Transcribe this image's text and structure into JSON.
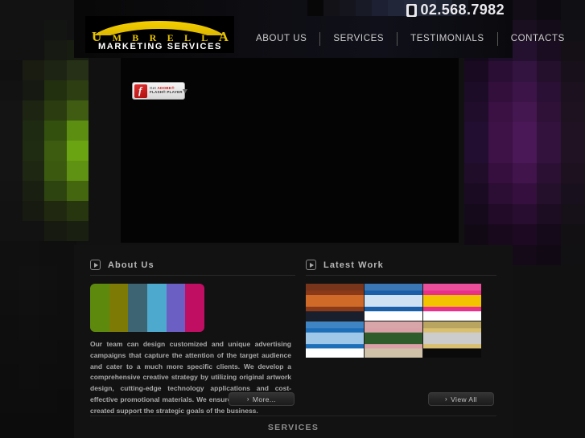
{
  "header": {
    "phone": "02.568.7982",
    "phone_icon": "phone-icon",
    "logo": {
      "word_letters": [
        "U",
        "M",
        "B",
        "R",
        "E",
        "L",
        "L",
        "A"
      ],
      "name": "UMBRELLA",
      "tagline": "MARKETING SERVICES"
    },
    "nav": [
      {
        "label": "ABOUT US"
      },
      {
        "label": "SERVICES"
      },
      {
        "label": "TESTIMONIALS"
      },
      {
        "label": "CONTACTS"
      }
    ]
  },
  "stage": {
    "flash_badge": {
      "line1_prefix": "Get ",
      "line1_brand": "ADOBE®",
      "line2": "FLASH® PLAYER",
      "icon": "adobe-flash-icon",
      "arrow_icon": "download-arrow-icon"
    }
  },
  "about": {
    "section_icon": "play-icon",
    "title": "About Us",
    "banner_colors": [
      "#5d8a0d",
      "#7d7a06",
      "#3c6473",
      "#4ea9ce",
      "#6c5fc4",
      "#c00f63"
    ],
    "body": "Our team can design customized and unique advertising campaigns that capture the attention of the target audience and cater to a much more specific clients. We develop a comprehensive creative strategy by utilizing original artwork design, cutting-edge technology applications and cost-effective promotional materials. We ensure that the materials created support the strategic goals of the business.",
    "more_button": {
      "label": "More...",
      "chevron": "›"
    }
  },
  "latest_work": {
    "section_icon": "play-icon",
    "title": "Latest Work",
    "thumbnails": [
      {
        "name": "thumbnail-runner-site",
        "colors": [
          "#1a1f2e",
          "#8a3a18",
          "#d06a28"
        ]
      },
      {
        "name": "thumbnail-blue-portal-site",
        "colors": [
          "#ffffff",
          "#1a5fa8",
          "#cfe2f3"
        ]
      },
      {
        "name": "thumbnail-colorful-infographic-site",
        "colors": [
          "#ffffff",
          "#e8308a",
          "#f3c300"
        ]
      },
      {
        "name": "thumbnail-city-corporate-site",
        "colors": [
          "#ffffff",
          "#1d6fb8",
          "#9fc7e8"
        ]
      },
      {
        "name": "thumbnail-resort-villa-site",
        "colors": [
          "#cfc2a8",
          "#d9a0a8",
          "#2e5c2a"
        ]
      },
      {
        "name": "thumbnail-jewelry-dark-site",
        "colors": [
          "#0a0a0a",
          "#d8c070",
          "#cccccc"
        ]
      }
    ],
    "view_all_button": {
      "label": "View All",
      "chevron": "›"
    }
  },
  "services": {
    "label": "SERVICES"
  },
  "decor": {
    "mosaic_left": [
      "#121212",
      "#121212",
      "#121212",
      "#121212",
      "#121212",
      "#121212",
      "#131513",
      "#121212",
      "#121212",
      "#121212",
      "#161a12",
      "#181d12",
      "#101010",
      "#1a1c12",
      "#1e2413",
      "#263016",
      "#121212",
      "#151912",
      "#22300f",
      "#2d3f12",
      "#141414",
      "#1d2512",
      "#2a3c10",
      "#3f5c12",
      "#141414",
      "#1e2a11",
      "#33500f",
      "#5c8e12",
      "#141414",
      "#202c11",
      "#3d5c10",
      "#6aa412",
      "#141414",
      "#1e2711",
      "#3b5a10",
      "#5f9112",
      "#131313",
      "#1a2011",
      "#2e4410",
      "#44660f",
      "#121212",
      "#161a11",
      "#20290f",
      "#27360f",
      "#121212",
      "#121212",
      "#171a11",
      "#1a2011"
    ],
    "mosaic_right": [
      "#0a0a0c",
      "#0d0a10",
      "#120d16",
      "#0e0a12",
      "#101014",
      "#0d0a10",
      "#140d1a",
      "#1a0f20",
      "#140c18",
      "#111014",
      "#12091a",
      "#1c0d28",
      "#24112f",
      "#1a0d22",
      "#141016",
      "#190a22",
      "#2a0e33",
      "#33133f",
      "#24102c",
      "#18111c",
      "#1d0c28",
      "#330f3c",
      "#3d1448",
      "#2a1034",
      "#1c111f",
      "#200d2c",
      "#3a1142",
      "#451750",
      "#2f1138",
      "#1e1221",
      "#220e30",
      "#3e1246",
      "#4a1856",
      "#33123d",
      "#201223",
      "#220e30",
      "#3e1246",
      "#4a1856",
      "#33123d",
      "#201223",
      "#1f0d2a",
      "#370f3e",
      "#42144c",
      "#2c1034",
      "#1d1120",
      "#1a0b22",
      "#2c0d33",
      "#35103e",
      "#24102b",
      "#19101d",
      "#150a1c",
      "#220b28",
      "#290d30",
      "#1c0d22",
      "#161018",
      "#110a15",
      "#19091d",
      "#1d0a22",
      "#150a19",
      "#131014",
      "#0e0a10",
      "#120915",
      "#150a18",
      "#110a14",
      "#111013"
    ],
    "mosaic_top": [
      "#070708",
      "#121217",
      "#15151d",
      "#181a26",
      "#1c2032",
      "#212638",
      "#242a3c",
      "#222838",
      "#1d2230",
      "#141620"
    ],
    "mosaic_bottom_left": [
      "#101010",
      "#101010",
      "#0f0f0f",
      "#0f0f0f",
      "#101010",
      "#111111",
      "#101010",
      "#0f0f0f",
      "#0f0f0f",
      "#101010",
      "#0f0f0f",
      "#0e0e0e",
      "#0e0e0e",
      "#0f0f0f",
      "#0e0e0e",
      "#0e0e0e",
      "#0e0e0e",
      "#0e0e0e",
      "#0e0e0e",
      "#0d0d0d",
      "#0d0d0d",
      "#0e0e0e",
      "#0d0d0d",
      "#0d0d0d",
      "#0d0d0d",
      "#0d0d0d",
      "#0d0d0d",
      "#0c0c0c",
      "#0c0c0c",
      "#0c0c0c",
      "#0c0c0c",
      "#0c0c0c"
    ]
  }
}
